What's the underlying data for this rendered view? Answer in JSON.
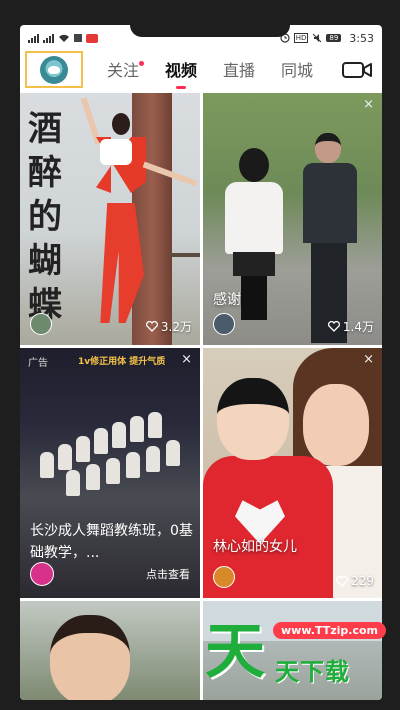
{
  "status_bar": {
    "hd": "HD",
    "battery": "89",
    "time": "3:53"
  },
  "nav": {
    "tabs": [
      {
        "label": "关注"
      },
      {
        "label": "视频"
      },
      {
        "label": "直播"
      },
      {
        "label": "同城"
      }
    ],
    "active_tab": "视频",
    "accent_color": "#ff2c55"
  },
  "feed": {
    "cards": [
      {
        "calligraphy": "酒醉的蝴蝶",
        "likes": "3.2万"
      },
      {
        "title": "感谢",
        "likes": "1.4万",
        "close": "×"
      },
      {
        "ad_label": "广告",
        "ad_banner": "1v修正用体  提升气质",
        "title": "长沙成人舞蹈教练班，0基础教学，...",
        "cta": "点击查看",
        "close": "×"
      },
      {
        "title": "林心如的女儿",
        "likes": "229",
        "close": "×"
      }
    ]
  },
  "watermark": {
    "big": "天",
    "url": "www.TTzip.com",
    "sub": "天下载"
  }
}
